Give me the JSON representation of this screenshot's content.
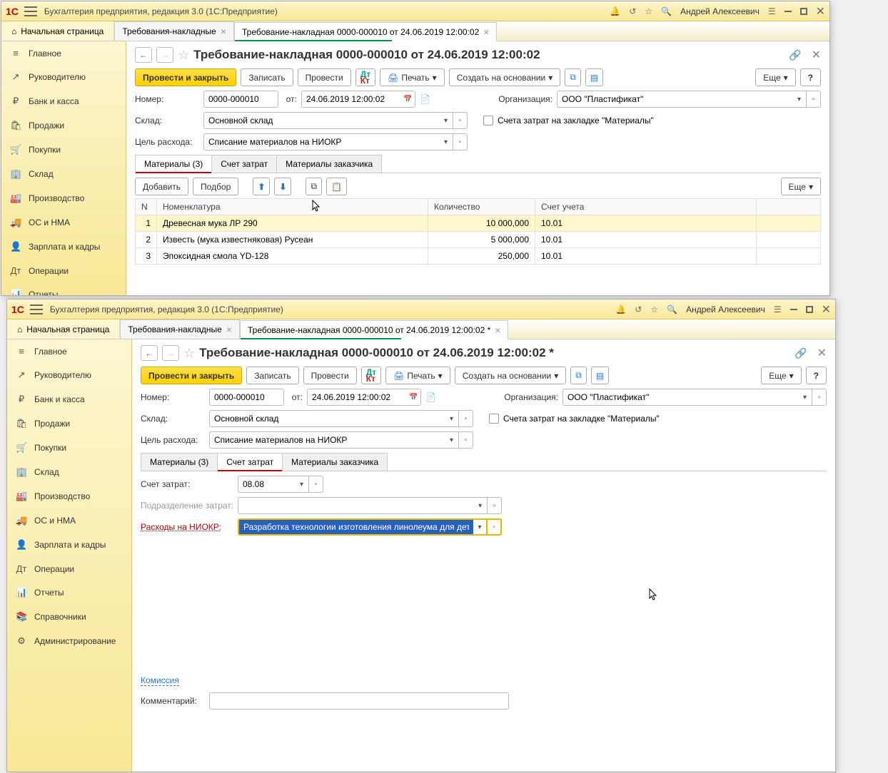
{
  "win1": {
    "title": "Бухгалтерия предприятия, редакция 3.0  (1С:Предприятие)",
    "user": "Андрей Алексеевич",
    "home_tab": "Начальная страница",
    "tabs": [
      {
        "label": "Требования-накладные",
        "active": false
      },
      {
        "label": "Требование-накладная 0000-000010 от 24.06.2019 12:00:02",
        "active": true
      }
    ],
    "sidebar": [
      {
        "icon": "≡",
        "label": "Главное"
      },
      {
        "icon": "↗",
        "label": "Руководителю"
      },
      {
        "icon": "₽",
        "label": "Банк и касса"
      },
      {
        "icon": "🛍",
        "label": "Продажи"
      },
      {
        "icon": "🛒",
        "label": "Покупки"
      },
      {
        "icon": "🏢",
        "label": "Склад"
      },
      {
        "icon": "🏭",
        "label": "Производство"
      },
      {
        "icon": "🚚",
        "label": "ОС и НМА"
      },
      {
        "icon": "👤",
        "label": "Зарплата и кадры"
      },
      {
        "icon": "Дт",
        "label": "Операции"
      },
      {
        "icon": "📊",
        "label": "Отчеты"
      }
    ],
    "doc_title": "Требование-накладная 0000-000010 от 24.06.2019 12:00:02",
    "btn_primary": "Провести и закрыть",
    "btn_write": "Записать",
    "btn_post": "Провести",
    "btn_print": "Печать",
    "btn_create": "Создать на основании",
    "btn_more": "Еще",
    "label_number": "Номер:",
    "value_number": "0000-000010",
    "label_date": "от:",
    "value_date": "24.06.2019 12:00:02",
    "label_org": "Организация:",
    "value_org": "ООО \"Пластификат\"",
    "label_sklad": "Склад:",
    "value_sklad": "Основной склад",
    "label_cost_check": "Счета затрат на закладке \"Материалы\"",
    "label_purpose": "Цель расхода:",
    "value_purpose": "Списание материалов на НИОКР",
    "sub_tabs": [
      {
        "label": "Материалы (3)",
        "active": true
      },
      {
        "label": "Счет затрат",
        "active": false
      },
      {
        "label": "Материалы заказчика",
        "active": false
      }
    ],
    "btn_add": "Добавить",
    "btn_select": "Подбор",
    "table_headers": {
      "n": "N",
      "nom": "Номенклатура",
      "qty": "Количество",
      "acc": "Счет учета"
    },
    "table_rows": [
      {
        "n": 1,
        "nom": "Древесная мука ЛР 290",
        "qty": "10 000,000",
        "acc": "10.01"
      },
      {
        "n": 2,
        "nom": "Известь (мука известняковая) Русеан",
        "qty": "5 000,000",
        "acc": "10.01"
      },
      {
        "n": 3,
        "nom": "Эпоксидная смола YD-128",
        "qty": "250,000",
        "acc": "10.01"
      }
    ]
  },
  "win2": {
    "title": "Бухгалтерия предприятия, редакция 3.0  (1С:Предприятие)",
    "user": "Андрей Алексеевич",
    "home_tab": "Начальная страница",
    "tabs": [
      {
        "label": "Требования-накладные",
        "active": false
      },
      {
        "label": "Требование-накладная 0000-000010 от 24.06.2019 12:00:02 *",
        "active": true
      }
    ],
    "sidebar": [
      {
        "icon": "≡",
        "label": "Главное"
      },
      {
        "icon": "↗",
        "label": "Руководителю"
      },
      {
        "icon": "₽",
        "label": "Банк и касса"
      },
      {
        "icon": "🛍",
        "label": "Продажи"
      },
      {
        "icon": "🛒",
        "label": "Покупки"
      },
      {
        "icon": "🏢",
        "label": "Склад"
      },
      {
        "icon": "🏭",
        "label": "Производство"
      },
      {
        "icon": "🚚",
        "label": "ОС и НМА"
      },
      {
        "icon": "👤",
        "label": "Зарплата и кадры"
      },
      {
        "icon": "Дт",
        "label": "Операции"
      },
      {
        "icon": "📊",
        "label": "Отчеты"
      },
      {
        "icon": "📚",
        "label": "Справочники"
      },
      {
        "icon": "⚙",
        "label": "Администрирование"
      }
    ],
    "doc_title": "Требование-накладная 0000-000010 от 24.06.2019 12:00:02 *",
    "sub_tabs": [
      {
        "label": "Материалы (3)",
        "active": false
      },
      {
        "label": "Счет затрат",
        "active": true
      },
      {
        "label": "Материалы заказчика",
        "active": false
      }
    ],
    "label_cost_acc": "Счет затрат:",
    "value_cost_acc": "08.08",
    "label_dept": "Подразделение затрат:",
    "value_dept": "",
    "label_niokr": "Расходы на НИОКР:",
    "value_niokr": "Разработка технологии изготовления линолеума для детски",
    "link_commission": "Комиссия",
    "label_comment": "Комментарий:",
    "value_comment": ""
  }
}
